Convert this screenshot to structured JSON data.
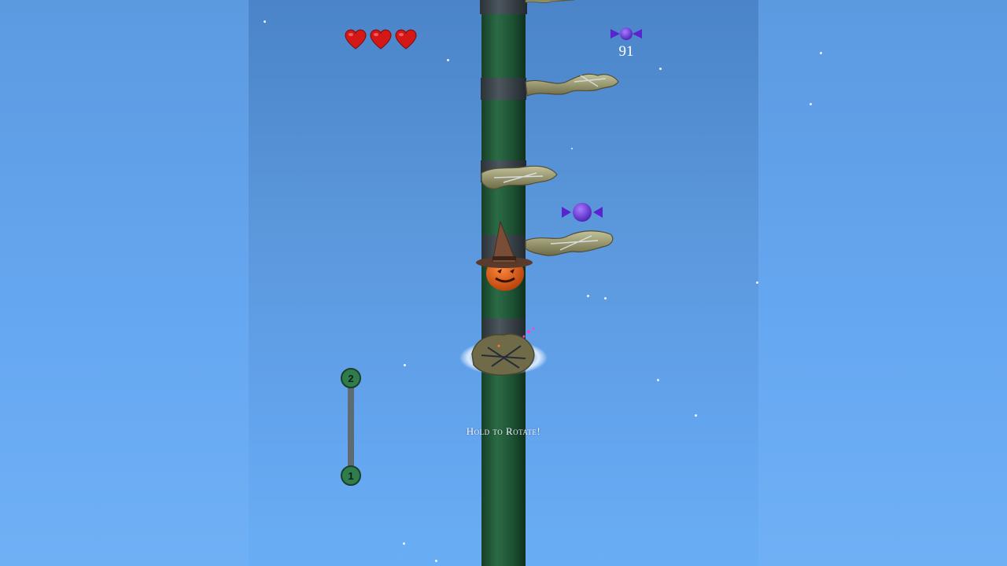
{
  "hud": {
    "lives": 3,
    "lives_icon": "heart-icon",
    "candy_icon": "candy-icon",
    "candy_count": "91"
  },
  "level_progress": {
    "current_level": "1",
    "next_level": "2"
  },
  "hint_text": "Hold to Rotate!",
  "colors": {
    "pole": "#1f5a36",
    "heart": "#d41818",
    "candy": "#6a2de0",
    "progress_node": "#2f7d4c",
    "sky": "#5b97db"
  }
}
